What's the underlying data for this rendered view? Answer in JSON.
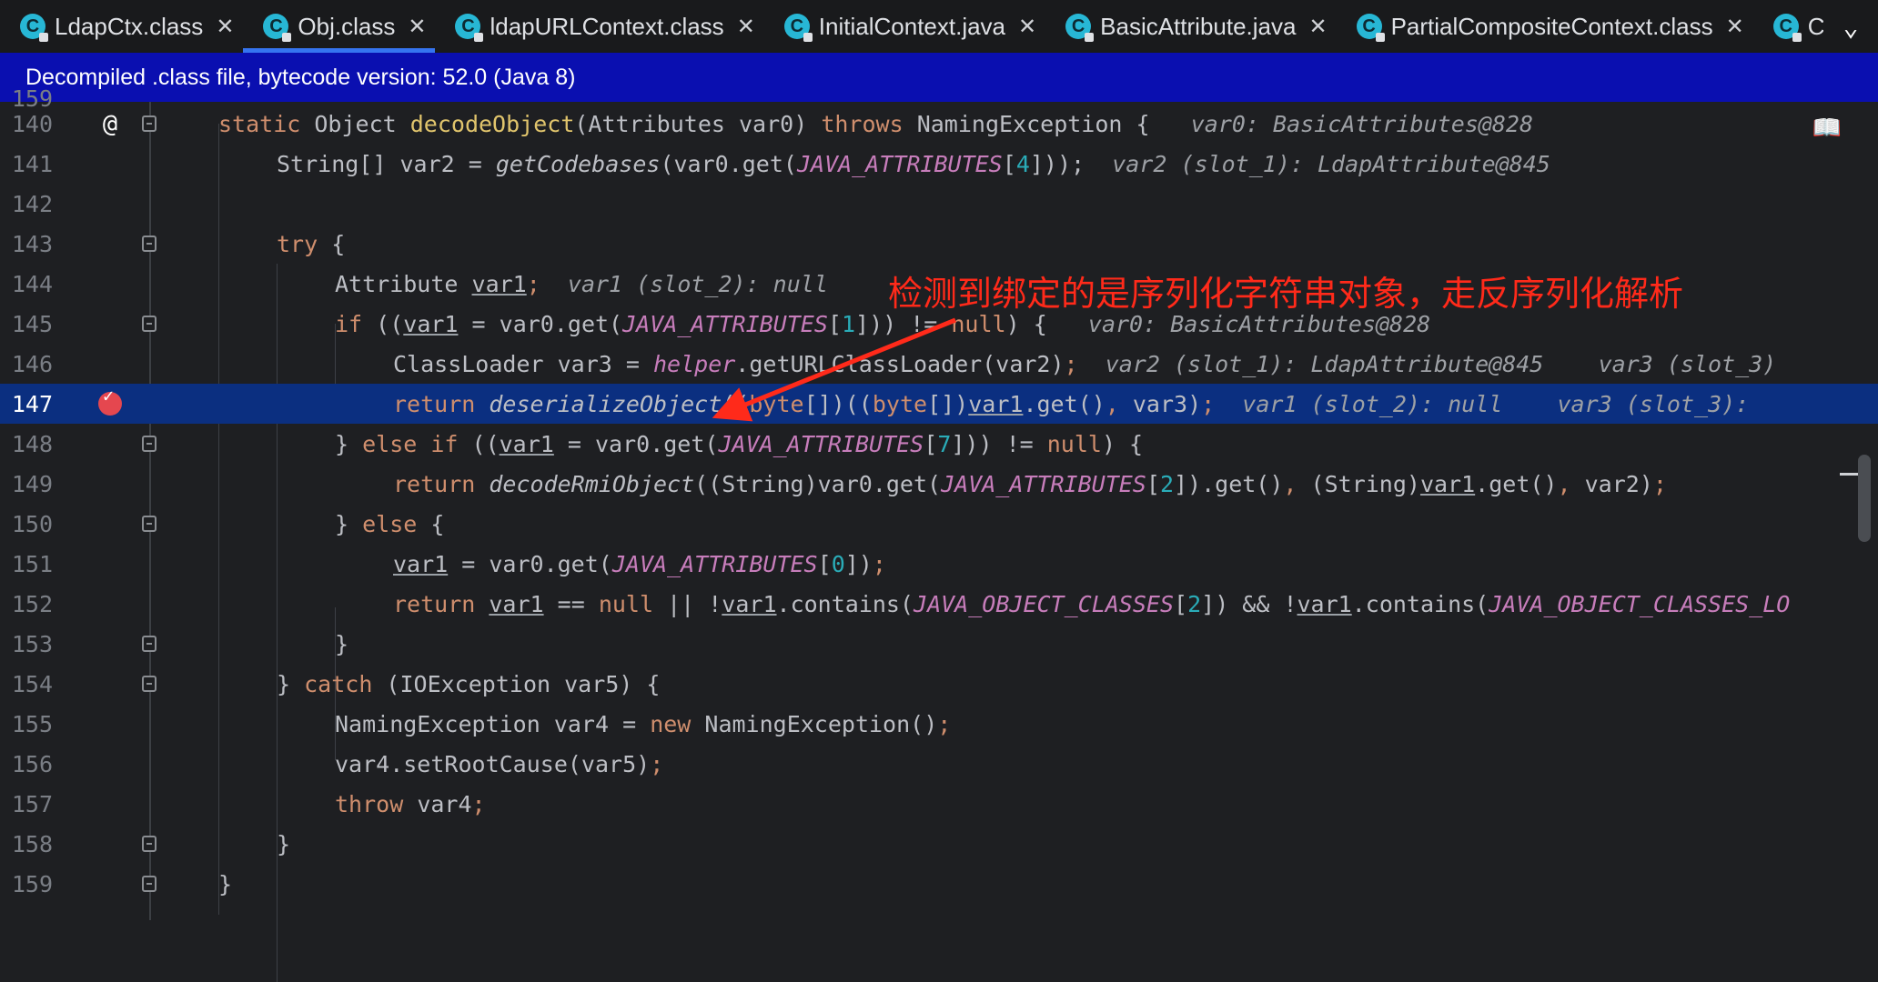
{
  "tabs": [
    {
      "label": "LdapCtx.class",
      "active": false
    },
    {
      "label": "Obj.class",
      "active": true
    },
    {
      "label": "ldapURLContext.class",
      "active": false
    },
    {
      "label": "InitialContext.java",
      "active": false
    },
    {
      "label": "BasicAttribute.java",
      "active": false
    },
    {
      "label": "PartialCompositeContext.class",
      "active": false
    },
    {
      "label": "Compo",
      "active": false
    }
  ],
  "banner": {
    "text": "Decompiled .class file, bytecode version: 52.0 (Java 8)"
  },
  "gutter_icons": {
    "override_marker": "@",
    "breakpoint": "breakpoint-icon"
  },
  "annotation": {
    "text": "检测到绑定的是序列化字符串对象，走反序列化解析"
  },
  "line_numbers": [
    "140",
    "141",
    "142",
    "143",
    "144",
    "145",
    "146",
    "147",
    "148",
    "149",
    "150",
    "151",
    "152",
    "153",
    "154",
    "155",
    "156",
    "157",
    "158",
    "159"
  ],
  "current_line": "147",
  "code_tokens": {
    "l140": [
      "static",
      "Object",
      "decodeObject",
      "(Attributes var0)",
      "throws",
      "NamingException {",
      "var0: BasicAttributes@828"
    ],
    "l141": [
      "String[] var2 = ",
      "getCodebases",
      "(var0.get(",
      "JAVA_ATTRIBUTES",
      "[",
      "4",
      "]));",
      "var2 (slot_1): LdapAttribute@845"
    ],
    "l143": [
      "try",
      " {"
    ],
    "l144": [
      "Attribute ",
      "var1",
      ";",
      "var1 (slot_2): null"
    ],
    "l145": [
      "if",
      " ((",
      "var1",
      " = var0.get(",
      "JAVA_ATTRIBUTES",
      "[",
      "1",
      "])) != ",
      "null",
      ") {",
      "var0: BasicAttributes@828"
    ],
    "l146": [
      "ClassLoader var3 = ",
      "helper",
      ".getURLClassLoader(var2)",
      ";",
      "var2 (slot_1): LdapAttribute@845",
      "var3 (slot_3)"
    ],
    "l147": [
      "return",
      "deserializeObject",
      "((",
      "byte",
      "[])((",
      "byte",
      "[])",
      "var1",
      ".get()",
      ",",
      " var3)",
      ";",
      "var1 (slot_2): null",
      "var3 (slot_3):"
    ],
    "l148": [
      "} ",
      "else if",
      " ((",
      "var1",
      " = var0.get(",
      "JAVA_ATTRIBUTES",
      "[",
      "7",
      "])) != ",
      "null",
      ") {"
    ],
    "l149": [
      "return",
      "decodeRmiObject",
      "((String)var0.get(",
      "JAVA_ATTRIBUTES",
      "[",
      "2",
      "]).get()",
      ",",
      " (String)",
      "var1",
      ".get()",
      ",",
      " var2)",
      ";"
    ],
    "l150": [
      "} ",
      "else",
      " {"
    ],
    "l151": [
      "var1",
      " = var0.get(",
      "JAVA_ATTRIBUTES",
      "[",
      "0",
      "])",
      ";"
    ],
    "l152": [
      "return",
      "var1",
      " == ",
      "null",
      " || !",
      "var1",
      ".contains(",
      "JAVA_OBJECT_CLASSES",
      "[",
      "2",
      "]) && !",
      "var1",
      ".contains(",
      "JAVA_OBJECT_CLASSES_LO"
    ],
    "l153": [
      "}"
    ],
    "l154": [
      "} ",
      "catch",
      " (IOException var5) {"
    ],
    "l155": [
      "NamingException var4 = ",
      "new",
      " NamingException()",
      ";"
    ],
    "l156": [
      "var4.setRootCause(var5)",
      ";"
    ],
    "l157": [
      "throw",
      " var4",
      ";"
    ],
    "l158": [
      "}"
    ],
    "l159": [
      "}"
    ]
  },
  "colors": {
    "background": "#1e1f22",
    "banner": "#0a0fb0",
    "current_line_highlight": "#0b2f80",
    "annotation": "#ff2a1a",
    "breakpoint": "#e5474f",
    "keyword": "#cf8e6d",
    "method_declaration": "#e0c46c",
    "constant": "#c77dbb",
    "number": "#2aacb8"
  }
}
